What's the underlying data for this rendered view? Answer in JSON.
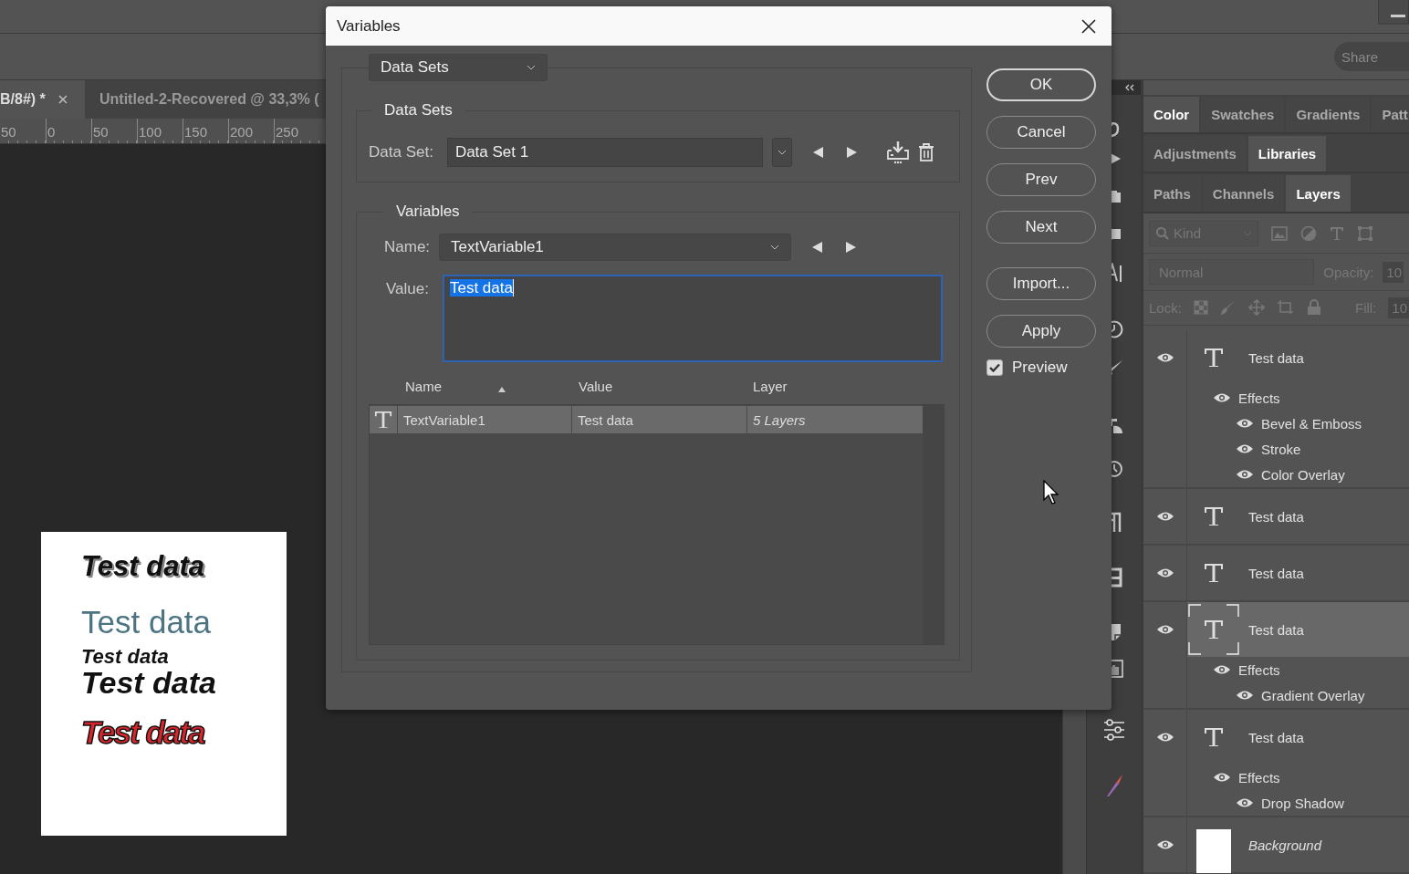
{
  "options_bar": {
    "share_button": "Share"
  },
  "document_tabs": [
    {
      "label": "B/8#) *",
      "selected": true
    },
    {
      "label": "Untitled-2-Recovered @ 33,3% (",
      "selected": false
    }
  ],
  "ruler": {
    "ticks": [
      "50",
      "0",
      "50",
      "100",
      "150",
      "200",
      "250"
    ]
  },
  "artboard": {
    "texts": [
      {
        "text": "Test data",
        "kind": "outlined"
      },
      {
        "text": "Test data",
        "kind": "light"
      },
      {
        "text": "Test data",
        "kind": "small"
      },
      {
        "text": "Test data",
        "kind": "bold"
      },
      {
        "text": "Test data",
        "kind": "red"
      }
    ]
  },
  "panel_tabs": [
    [
      {
        "label": "Color",
        "selected": true
      },
      {
        "label": "Swatches",
        "selected": false
      },
      {
        "label": "Gradients",
        "selected": false
      },
      {
        "label": "Patt",
        "selected": false
      }
    ],
    [
      {
        "label": "Adjustments",
        "selected": false
      },
      {
        "label": "Libraries",
        "selected": true
      }
    ],
    [
      {
        "label": "Paths",
        "selected": false
      },
      {
        "label": "Channels",
        "selected": false
      },
      {
        "label": "Layers",
        "selected": true
      }
    ]
  ],
  "layers_panel": {
    "filter": {
      "placeholder": "Kind"
    },
    "blend_mode": "Normal",
    "opacity_label": "Opacity:",
    "opacity_value": "10",
    "lock_label": "Lock:",
    "fill_label": "Fill:",
    "fill_value": "10",
    "layers": [
      {
        "name": "Test data",
        "kind": "text",
        "visible": true,
        "selected": false,
        "children": [
          {
            "name": "Effects",
            "visible": true,
            "children": [
              {
                "name": "Bevel & Emboss",
                "visible": true
              },
              {
                "name": "Stroke",
                "visible": true
              },
              {
                "name": "Color Overlay",
                "visible": true
              }
            ]
          }
        ]
      },
      {
        "name": "Test data",
        "kind": "text",
        "visible": true,
        "selected": false
      },
      {
        "name": "Test data",
        "kind": "text",
        "visible": true,
        "selected": false
      },
      {
        "name": "Test data",
        "kind": "text",
        "visible": true,
        "selected": true,
        "children": [
          {
            "name": "Effects",
            "visible": true,
            "children": [
              {
                "name": "Gradient Overlay",
                "visible": true
              }
            ]
          }
        ]
      },
      {
        "name": "Test data",
        "kind": "text",
        "visible": true,
        "selected": false,
        "children": [
          {
            "name": "Effects",
            "visible": true,
            "children": [
              {
                "name": "Drop Shadow",
                "visible": true
              }
            ]
          }
        ]
      },
      {
        "name": "Background",
        "kind": "image",
        "visible": true,
        "selected": false
      }
    ]
  },
  "dialog": {
    "title": "Variables",
    "mode_select": "Data Sets",
    "data_sets": {
      "legend": "Data Sets",
      "label": "Data Set:",
      "value": "Data Set 1"
    },
    "variables": {
      "legend": "Variables",
      "name_label": "Name:",
      "name_value": "TextVariable1",
      "value_label": "Value:",
      "value": "Test data"
    },
    "table": {
      "columns": [
        {
          "label": "Name",
          "sorted": true
        },
        {
          "label": "Value",
          "sorted": false
        },
        {
          "label": "Layer",
          "sorted": false
        }
      ],
      "rows": [
        {
          "cells": [
            "TextVariable1",
            "Test data",
            "5 Layers"
          ],
          "selected": true
        }
      ]
    },
    "buttons": [
      {
        "label": "OK",
        "default": true
      },
      {
        "label": "Cancel",
        "default": false
      },
      {
        "label": "Prev",
        "default": false
      },
      {
        "label": "Next",
        "default": false
      },
      {
        "label": "Import...",
        "default": false
      },
      {
        "label": "Apply",
        "default": false
      }
    ],
    "preview": {
      "label": "Preview",
      "checked": true
    }
  }
}
